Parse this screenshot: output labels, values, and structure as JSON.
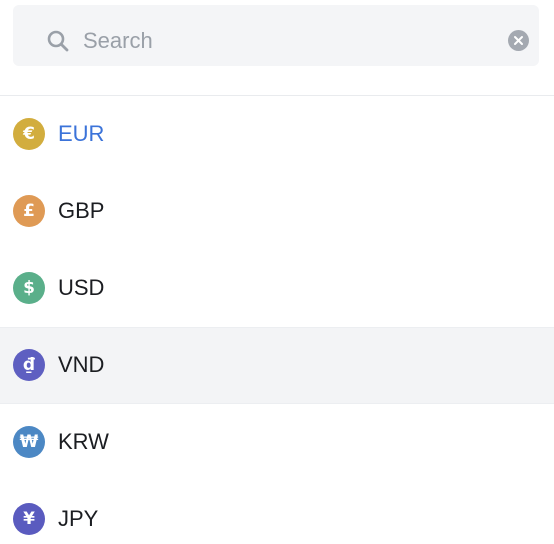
{
  "search": {
    "placeholder": "Search",
    "value": ""
  },
  "colors": {
    "selected_text": "#3b73d9",
    "hover_bg": "#f3f4f6"
  },
  "currencies": [
    {
      "code": "EUR",
      "symbol": "€",
      "color": "#d2ad3e",
      "state": "selected"
    },
    {
      "code": "GBP",
      "symbol": "£",
      "color": "#df9a55",
      "state": "normal"
    },
    {
      "code": "USD",
      "symbol": "$",
      "color": "#5aaf8a",
      "state": "normal"
    },
    {
      "code": "VND",
      "symbol": "₫",
      "color": "#5e5fc1",
      "state": "hovered"
    },
    {
      "code": "KRW",
      "symbol": "₩",
      "color": "#4c88c4",
      "state": "normal"
    },
    {
      "code": "JPY",
      "symbol": "¥",
      "color": "#5a5bbf",
      "state": "normal"
    }
  ]
}
